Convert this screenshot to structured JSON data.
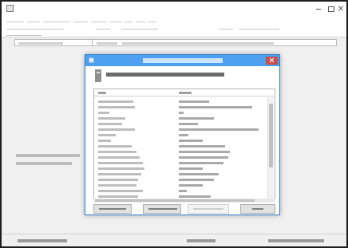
{
  "window": {
    "title": ""
  },
  "colors": {
    "dialog_title_bar": "#4da0f0",
    "dialog_close": "#c75050",
    "dialog_border": "#2d7fd0"
  },
  "menu": {
    "items": [
      "",
      "",
      "",
      "",
      "",
      "",
      "",
      "",
      ""
    ]
  },
  "toolbar": {
    "items": [
      "",
      "",
      "",
      "",
      "",
      ""
    ]
  },
  "driver_list": {
    "cells": [
      "",
      "",
      ""
    ]
  },
  "left_panel": {
    "lines": [
      "",
      ""
    ]
  },
  "status": {
    "cells": [
      "",
      "",
      ""
    ]
  },
  "dialog": {
    "title": "",
    "heading": "",
    "columns": [
      "",
      ""
    ],
    "rows": [
      {
        "name": "",
        "value": ""
      },
      {
        "name": "",
        "value": ""
      },
      {
        "name": "",
        "value": ""
      },
      {
        "name": "",
        "value": ""
      },
      {
        "name": "",
        "value": ""
      },
      {
        "name": "",
        "value": ""
      },
      {
        "name": "",
        "value": ""
      },
      {
        "name": "",
        "value": ""
      },
      {
        "name": "",
        "value": ""
      },
      {
        "name": "",
        "value": ""
      },
      {
        "name": "",
        "value": ""
      },
      {
        "name": "",
        "value": ""
      },
      {
        "name": "",
        "value": ""
      },
      {
        "name": "",
        "value": ""
      },
      {
        "name": "",
        "value": ""
      },
      {
        "name": "",
        "value": ""
      },
      {
        "name": "",
        "value": ""
      },
      {
        "name": "",
        "value": ""
      }
    ],
    "buttons": [
      {
        "label": "",
        "enabled": true
      },
      {
        "label": "",
        "enabled": true
      },
      {
        "label": "",
        "enabled": false
      },
      {
        "label": "",
        "enabled": true
      }
    ]
  }
}
